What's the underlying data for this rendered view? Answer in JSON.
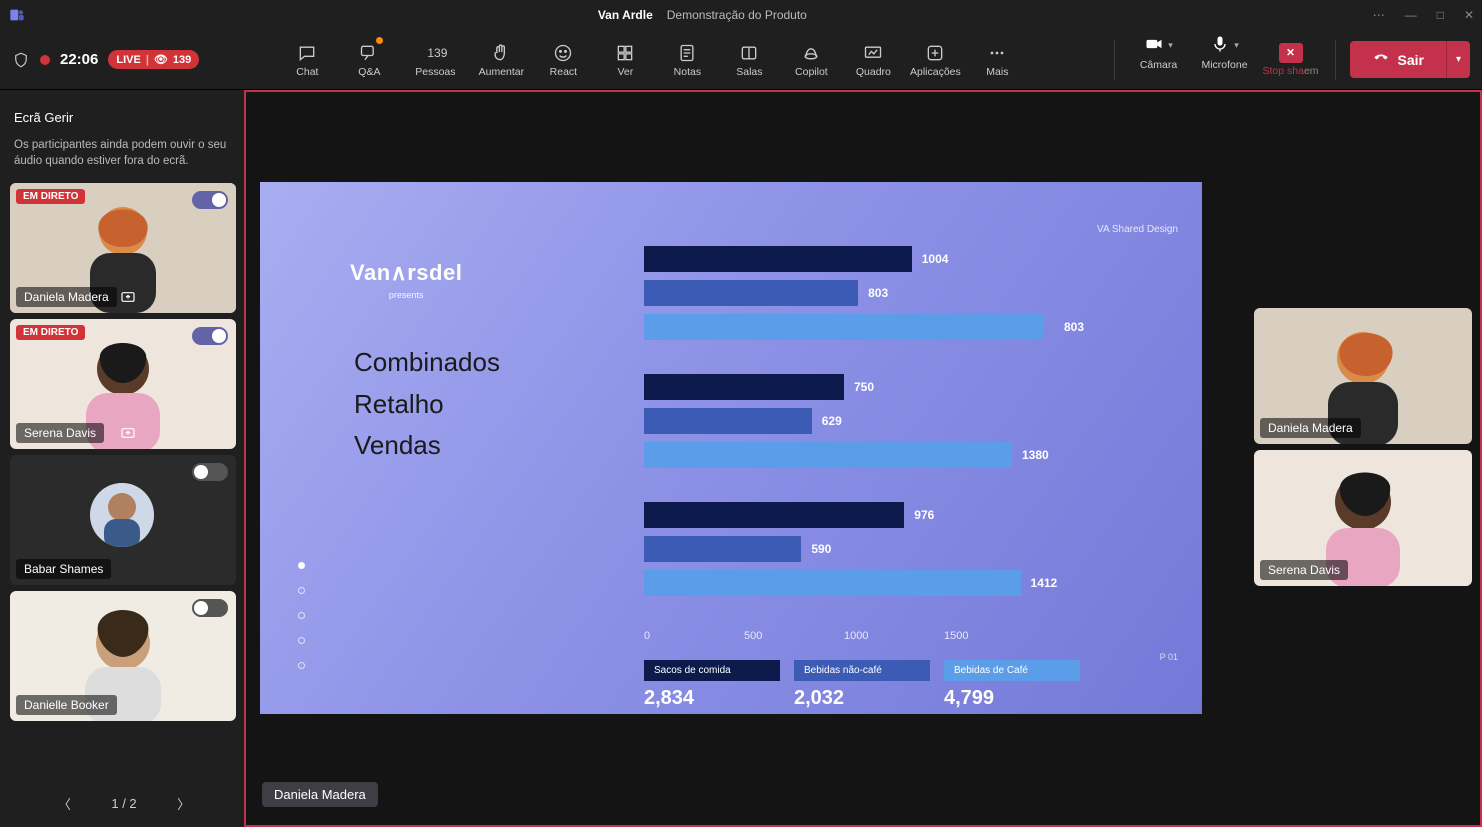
{
  "titlebar": {
    "meeting_owner": "Van Ardle",
    "meeting_name": "Demonstração do Produto"
  },
  "status": {
    "time": "22:06",
    "live_label": "LIVE",
    "viewer_count": "139"
  },
  "toolbar": {
    "chat": "Chat",
    "qa": "Q&A",
    "people": "Pessoas",
    "people_count": "139",
    "raise": "Aumentar",
    "react": "React",
    "view": "Ver",
    "notes": "Notas",
    "rooms": "Salas",
    "copilot": "Copilot",
    "whiteboard": "Quadro",
    "apps": "Aplicações",
    "more": "Mais"
  },
  "devices": {
    "camera": "Câmara",
    "microphone": "Microfone",
    "stopshare": "Stop sharing",
    "stopshare_suffix": "em",
    "leave": "Sair"
  },
  "sidebar": {
    "title": "Ecrã Gerir",
    "note": "Os participantes ainda podem ouvir o seu áudio quando estiver fora do ecrã.",
    "live_tag": "EM DIRETO",
    "participants": [
      {
        "name": "Daniela Madera",
        "live": true,
        "toggle_on": true,
        "avatar_only": false
      },
      {
        "name": "Serena Davis",
        "live": true,
        "toggle_on": true,
        "avatar_only": false
      },
      {
        "name": "Babar Shames",
        "live": false,
        "toggle_on": false,
        "avatar_only": true
      },
      {
        "name": "Danielle Booker",
        "live": false,
        "toggle_on": false,
        "avatar_only": false
      }
    ],
    "pager": {
      "current": "1",
      "total": "2"
    }
  },
  "right_participants": [
    {
      "name": "Daniela Madera"
    },
    {
      "name": "Serena Davis"
    }
  ],
  "stage": {
    "presenter": "Daniela  Madera"
  },
  "slide": {
    "tag": "VA Shared Design",
    "brand": "Van∧rsdel",
    "present": "presents",
    "heading_1": "Combinados",
    "heading_2": "Retalho",
    "heading_3": "Vendas",
    "page": "P 01",
    "legend": {
      "s1": "Sacos de comida",
      "s2": "Bebidas não-café",
      "s3": "Bebidas de Café"
    },
    "totals": {
      "s1": "2,834",
      "s2": "2,032",
      "s3": "4,799"
    },
    "x_ticks": [
      "0",
      "500",
      "1000",
      "1500"
    ]
  },
  "chart_data": {
    "type": "bar",
    "orientation": "horizontal",
    "x_axis": {
      "min": 0,
      "max": 1500,
      "ticks": [
        0,
        500,
        1000,
        1500
      ]
    },
    "series": [
      {
        "name": "Sacos de comida",
        "color": "#0d1b4c",
        "values": [
          1004,
          750,
          976
        ]
      },
      {
        "name": "Bebidas não-café",
        "color": "#3b5bb5",
        "values": [
          803,
          629,
          590
        ]
      },
      {
        "name": "Bebidas de Café",
        "color": "#5b9de8",
        "values": [
          803,
          1380,
          1412
        ],
        "offscale_label_for_index0": 803
      }
    ],
    "groups": 3,
    "totals": {
      "Sacos de comida": 2834,
      "Bebidas não-café": 2032,
      "Bebidas de Café": 4799
    },
    "title": "Combinados Retalho Vendas",
    "brand": "VanArsdel"
  }
}
